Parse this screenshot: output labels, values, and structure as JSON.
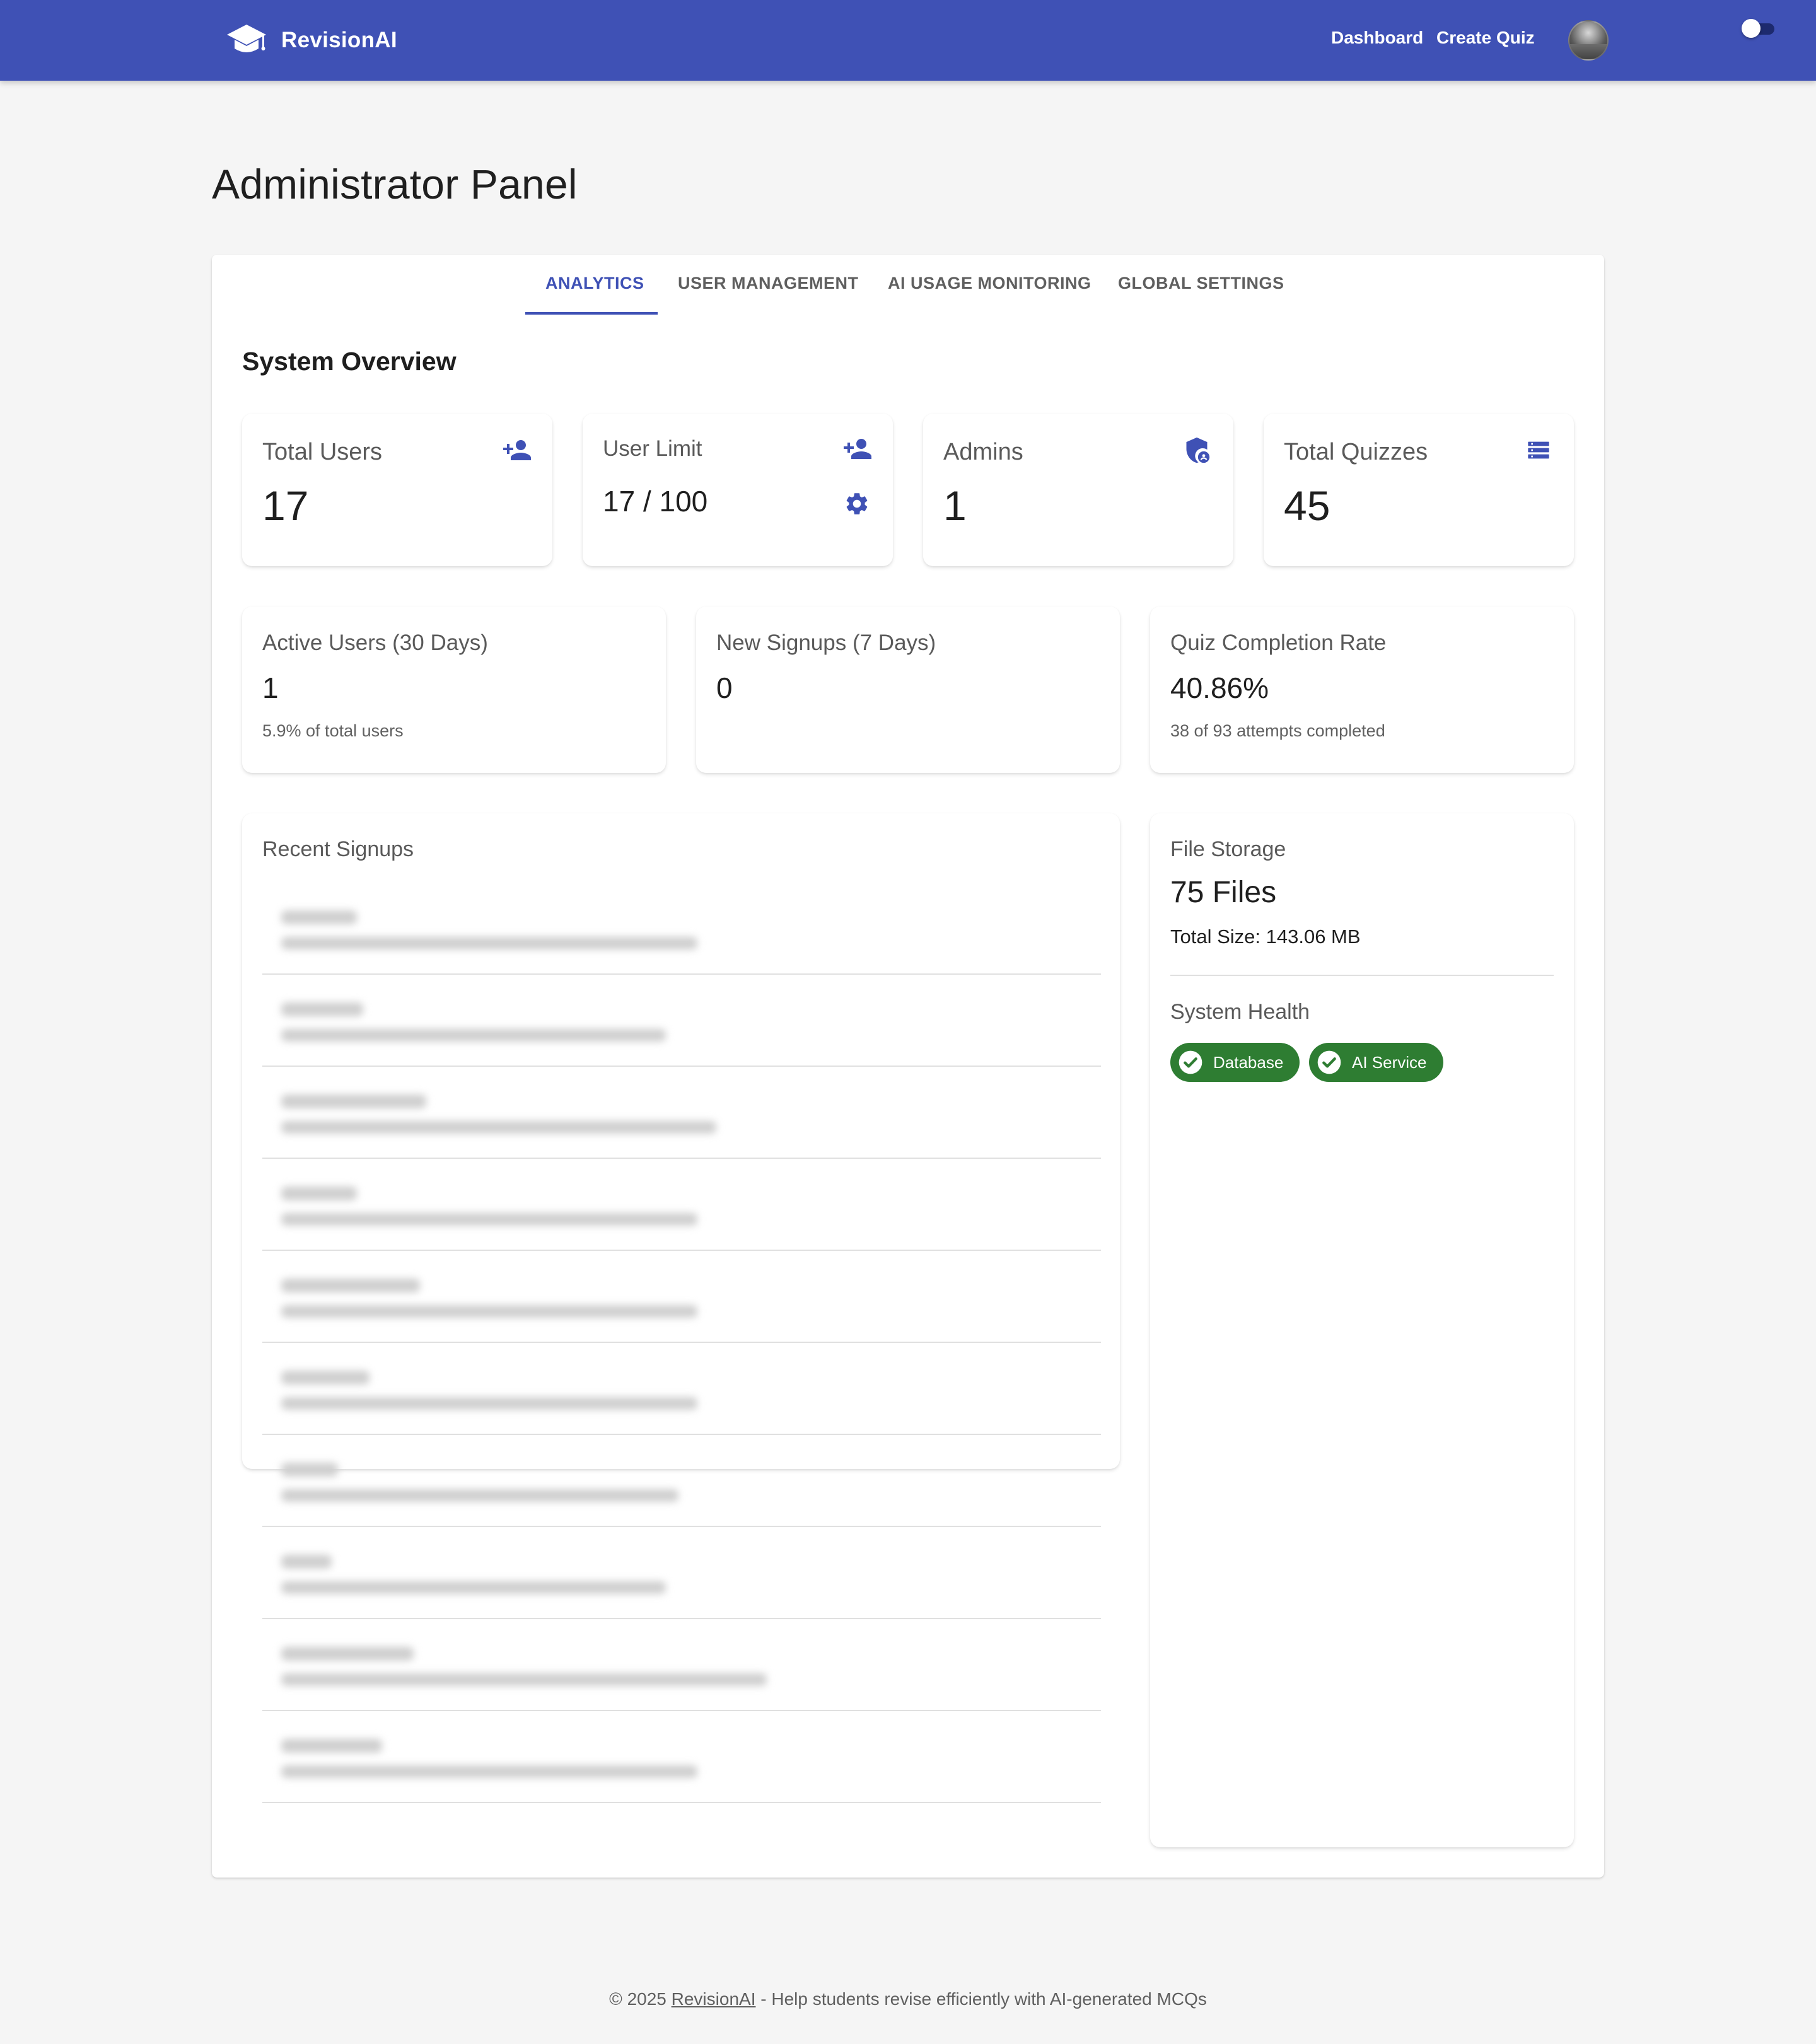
{
  "app": {
    "name": "RevisionAI"
  },
  "nav": {
    "dashboard": "Dashboard",
    "create_quiz": "Create Quiz"
  },
  "page": {
    "title": "Administrator Panel"
  },
  "tabs": [
    {
      "label": "ANALYTICS",
      "active": true
    },
    {
      "label": "USER MANAGEMENT",
      "active": false
    },
    {
      "label": "AI USAGE MONITORING",
      "active": false
    },
    {
      "label": "GLOBAL SETTINGS",
      "active": false
    }
  ],
  "overview": {
    "title": "System Overview",
    "total_users": {
      "label": "Total Users",
      "value": "17"
    },
    "user_limit": {
      "label": "User Limit",
      "value": "17 / 100"
    },
    "admins": {
      "label": "Admins",
      "value": "1"
    },
    "total_quizzes": {
      "label": "Total Quizzes",
      "value": "45"
    }
  },
  "metrics": {
    "active_users": {
      "label": "Active Users (30 Days)",
      "value": "1",
      "sub": "5.9% of total users"
    },
    "new_signups": {
      "label": "New Signups (7 Days)",
      "value": "0"
    },
    "completion": {
      "label": "Quiz Completion Rate",
      "value": "40.86%",
      "sub": "38 of 93 attempts completed"
    }
  },
  "recent_signups": {
    "title": "Recent Signups",
    "row_count": 10
  },
  "storage": {
    "title": "File Storage",
    "files": "75 Files",
    "total_size": "Total Size: 143.06 MB"
  },
  "health": {
    "title": "System Health",
    "items": [
      "Database",
      "AI Service"
    ]
  },
  "footer": {
    "prefix": "© 2025 ",
    "link": "RevisionAI",
    "suffix": " - Help students revise efficiently with AI-generated MCQs"
  },
  "colors": {
    "primary": "#3f51b5",
    "success": "#2e7d32",
    "background": "#f5f5f5",
    "toggle_track": "#1d2a6e"
  },
  "icons": {
    "brand": "graduation-cap-icon",
    "total_users": "person-add-icon",
    "user_limit": "person-add-icon",
    "user_limit_settings": "gear-icon",
    "admins": "admin-shield-icon",
    "total_quizzes": "list-icon",
    "health": "check-circle-icon"
  }
}
